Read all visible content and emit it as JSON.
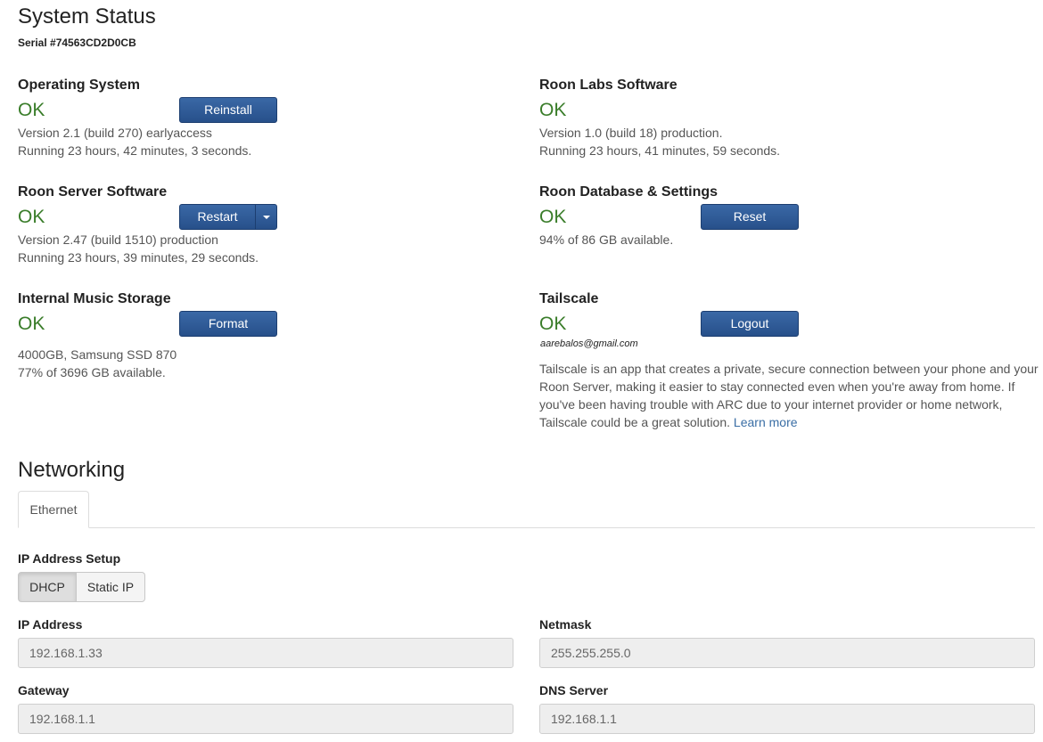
{
  "page": {
    "title": "System Status",
    "serial": "Serial #74563CD2D0CB"
  },
  "os": {
    "title": "Operating System",
    "status": "OK",
    "button": "Reinstall",
    "line1": "Version 2.1 (build 270) earlyaccess",
    "line2": "Running 23 hours, 42 minutes, 3 seconds."
  },
  "labs": {
    "title": "Roon Labs Software",
    "status": "OK",
    "line1": "Version 1.0 (build 18) production.",
    "line2": "Running 23 hours, 41 minutes, 59 seconds."
  },
  "server": {
    "title": "Roon Server Software",
    "status": "OK",
    "button": "Restart",
    "line1": "Version 2.47 (build 1510) production",
    "line2": "Running 23 hours, 39 minutes, 29 seconds."
  },
  "database": {
    "title": "Roon Database & Settings",
    "status": "OK",
    "button": "Reset",
    "line1": "94% of 86 GB available."
  },
  "storage": {
    "title": "Internal Music Storage",
    "status": "OK",
    "button": "Format",
    "line1": "4000GB, Samsung SSD 870",
    "line2": "77% of 3696 GB available."
  },
  "tailscale": {
    "title": "Tailscale",
    "status": "OK",
    "button": "Logout",
    "email": "aarebalos@gmail.com",
    "description": "Tailscale is an app that creates a private, secure connection between your phone and your Roon Server, making it easier to stay connected even when you're away from home. If you've been having trouble with ARC due to your internet provider or home network, Tailscale could be a great solution.",
    "learn_more": "Learn more"
  },
  "networking": {
    "title": "Networking",
    "tab": "Ethernet",
    "ip_setup_label": "IP Address Setup",
    "dhcp": "DHCP",
    "static_ip": "Static IP",
    "ip_label": "IP Address",
    "ip_value": "192.168.1.33",
    "netmask_label": "Netmask",
    "netmask_value": "255.255.255.0",
    "gateway_label": "Gateway",
    "gateway_value": "192.168.1.1",
    "dns_label": "DNS Server",
    "dns_value": "192.168.1.1"
  },
  "colors": {
    "ok_green": "#3a7d2a",
    "button_blue": "#2d5a96",
    "link_blue": "#3a6ea5"
  },
  "icons": {
    "dropdown": "caret-down-icon"
  }
}
